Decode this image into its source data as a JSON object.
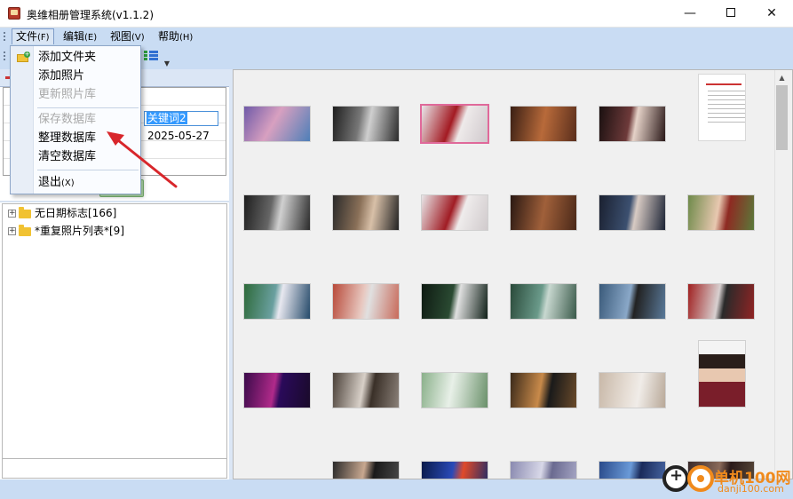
{
  "window": {
    "title": "奥维相册管理系统(v1.1.2)",
    "minimize_glyph": "—",
    "close_glyph": "✕"
  },
  "menubar": {
    "items": [
      {
        "label": "文件",
        "key": "(F)"
      },
      {
        "label": "编辑",
        "key": "(E)"
      },
      {
        "label": "视图",
        "key": "(V)"
      },
      {
        "label": "帮助",
        "key": "(H)"
      }
    ]
  },
  "file_menu": {
    "items": [
      {
        "label": "添加文件夹",
        "enabled": true,
        "icon": "folder-add-icon"
      },
      {
        "label": "添加照片",
        "enabled": true
      },
      {
        "label": "更新照片库",
        "enabled": false
      },
      {
        "label": "保存数据库",
        "enabled": false
      },
      {
        "label": "整理数据库",
        "enabled": true
      },
      {
        "label": "清空数据库",
        "enabled": true
      },
      {
        "label": "退出",
        "key": "(X)",
        "enabled": true
      }
    ]
  },
  "info": {
    "keyword_value": "关键词2",
    "date_value": "2025-05-27"
  },
  "tree": {
    "nodes": [
      {
        "label": "无日期标志[166]",
        "expander": "+"
      },
      {
        "label": "*重复照片列表*[9]",
        "expander": "+"
      }
    ]
  },
  "watermark": {
    "text": "单机100网",
    "url": "danji100.com"
  },
  "colors": {
    "menubar_bg": "#c9dcf3",
    "selection_border": "#e0699a",
    "arrow": "#d8262b",
    "watermark": "#f08a1c"
  }
}
